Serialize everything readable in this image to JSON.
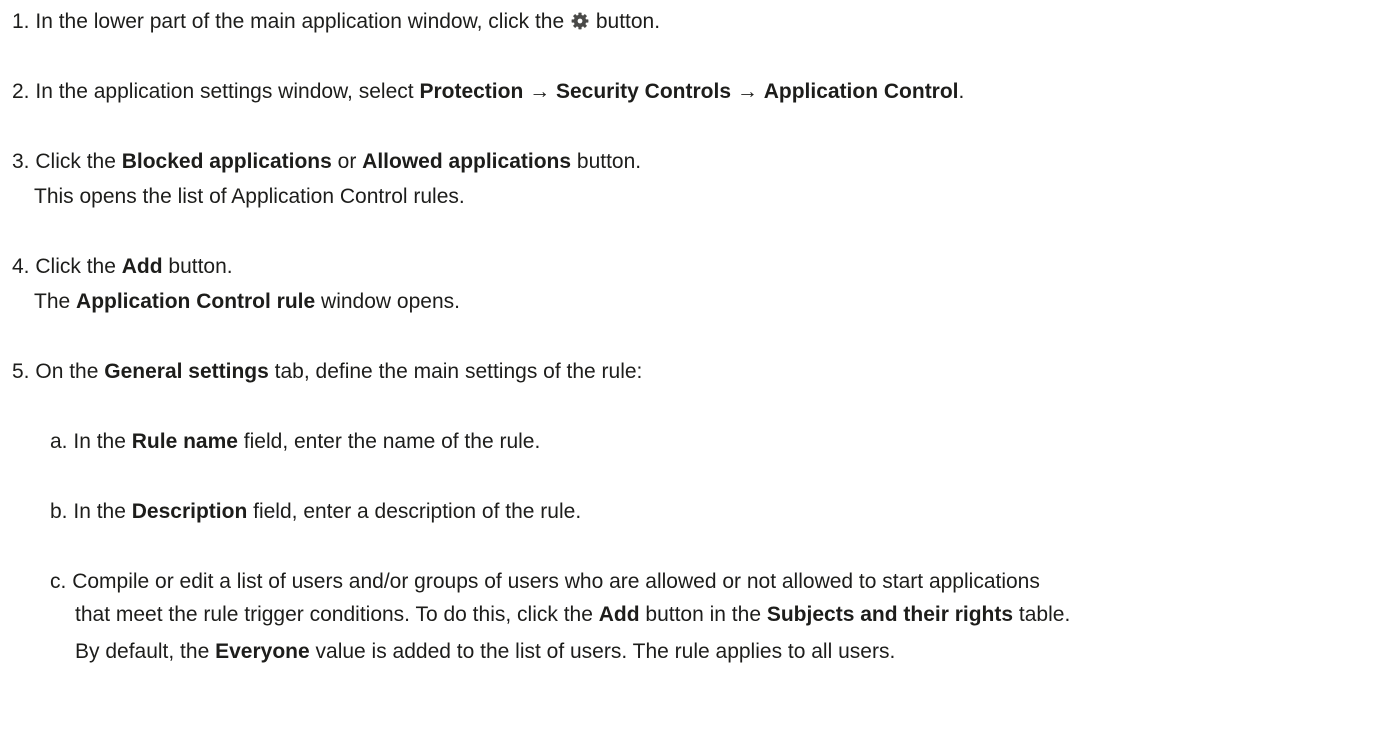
{
  "steps": {
    "s1": {
      "number": "1.",
      "t1": "In the lower part of the main application window, click the",
      "icon": "gear-icon",
      "t2": "button."
    },
    "s2": {
      "number": "2.",
      "t1": "In the application settings window, select",
      "b1": "Protection",
      "arrow1": "→",
      "b2": "Security Controls",
      "arrow2": "→",
      "b3": "Application Control",
      "t2": "."
    },
    "s3": {
      "number": "3.",
      "t1": "Click the",
      "b1": "Blocked applications",
      "t2": "or",
      "b2": "Allowed applications",
      "t3": "button.",
      "result": "This opens the list of Application Control rules."
    },
    "s4": {
      "number": "4.",
      "t1": "Click the",
      "b1": "Add",
      "t2": "button.",
      "r1": "The",
      "rb": "Application Control rule",
      "r2": "window opens."
    },
    "s5": {
      "number": "5.",
      "t1": "On the",
      "b1": "General settings",
      "t2": "tab, define the main settings of the rule:"
    }
  },
  "substeps": {
    "a": {
      "letter": "a.",
      "t1": "In the",
      "b1": "Rule name",
      "t2": "field, enter the name of the rule."
    },
    "b": {
      "letter": "b.",
      "t1": "In the",
      "b1": "Description",
      "t2": "field, enter a description of the rule."
    },
    "c": {
      "letter": "c.",
      "line1": "Compile or edit a list of users and/or groups of users who are allowed or not allowed to start applications",
      "l2a": "that meet the rule trigger conditions. To do this, click the",
      "l2b": "Add",
      "l2c": "button in the",
      "l2d": "Subjects and their rights",
      "l2e": "table.",
      "n1": "By default, the",
      "nb": "Everyone",
      "n2": "value is added to the list of users. The rule applies to all users."
    }
  }
}
